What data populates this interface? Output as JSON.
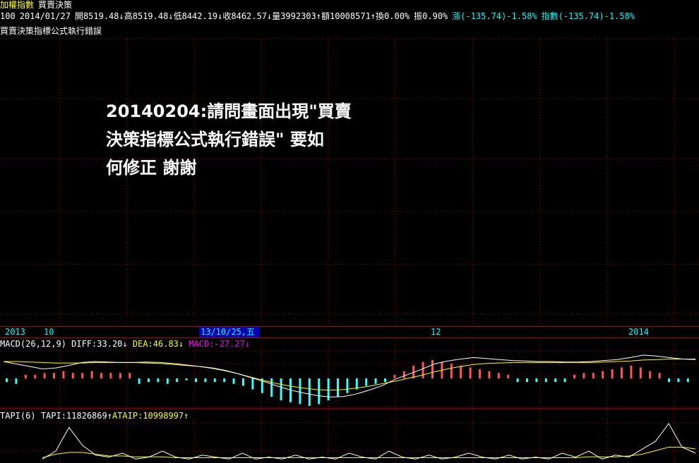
{
  "header": {
    "index_name": "加權指數",
    "strategy_name": "買賣決策",
    "period": "100",
    "date": "2014/01/27",
    "open": "開8519.48↓",
    "high": "高8519.48↓",
    "low": "低8442.19↓",
    "close": "收8462.57↓",
    "volume": "量3992303↑",
    "amount": "額10008571↑",
    "turnover": "換0.00%",
    "amplitude": "振0.90%",
    "change": "漲(-135.74)-1.58%",
    "index_change": "指數(-135.74)-1.58%"
  },
  "subtitle": "買賣決策指標公式執行錯誤",
  "question": {
    "line1": "20140204:請問畫面出現\"買賣",
    "line2": "決策指標公式執行錯誤\" 要如",
    "line3": "何修正  謝謝"
  },
  "axis": {
    "label_2013": "2013",
    "label_10": "10",
    "selected_date": "13/10/25,五",
    "label_12": "12",
    "label_2014": "2014"
  },
  "macd_legend": {
    "name": "MACD(26,12,9)",
    "diff": "DIFF:33.20↓",
    "dea": "DEA:46.83↓",
    "macd": "MACD:-27.27↓"
  },
  "tapi_legend": {
    "name": "TAPI(6)",
    "tapi": "TAPI:11826869↑",
    "ataip": "ATAIP:10998997↑"
  },
  "colors": {
    "grid": "#c00000",
    "bar_up": "#ff5555",
    "bar_down": "#33ffff",
    "diff_line": "#ffffff",
    "dea_line": "#ffff00"
  },
  "macd_histogram": [
    -2,
    -3,
    2,
    2,
    3,
    3,
    4,
    3,
    3,
    4,
    3,
    3,
    3,
    3,
    -3,
    -2,
    -2,
    -3,
    -2,
    -1,
    -2,
    -2,
    -2,
    -2,
    -3,
    -4,
    -6,
    -8,
    -10,
    -12,
    -13,
    -14,
    -15,
    -14,
    -12,
    -10,
    -8,
    -6,
    -4,
    -3,
    -2,
    2,
    4,
    7,
    9,
    10,
    9,
    8,
    7,
    6,
    5,
    4,
    3,
    2,
    -2,
    -2,
    -2,
    -2,
    -2,
    -2,
    2,
    3,
    3,
    4,
    5,
    6,
    7,
    6,
    4,
    3,
    -2,
    -2,
    -2
  ],
  "macd_diff": [
    1,
    0.5,
    0,
    -0.5,
    -0.3,
    0.2,
    0.8,
    1,
    0.9,
    0.8,
    0.8,
    0.9,
    0.8,
    0.6,
    0.3,
    0,
    -0.3,
    -0.8,
    -1.5,
    -2.3,
    -3.1,
    -4,
    -4.8,
    -5.4,
    -5.9,
    -6.2,
    -6.1,
    -5.6,
    -4.8,
    -3.9,
    -2.6,
    -1.6,
    -0.6,
    0.5,
    1.1,
    1.5,
    1.8,
    1.6,
    1.4,
    1.2,
    1.1,
    1,
    1,
    0.9,
    0.9,
    1,
    1.2,
    1.4,
    1.8,
    2.3,
    2.1,
    1.8,
    1.5,
    1.4
  ],
  "macd_dea": [
    1,
    1,
    0.9,
    0.8,
    0.7,
    0.7,
    0.7,
    0.8,
    0.8,
    0.8,
    0.8,
    0.7,
    0.6,
    0.4,
    0.2,
    0,
    -0.4,
    -0.9,
    -1.5,
    -2.2,
    -2.9,
    -3.5,
    -4,
    -4.4,
    -4.7,
    -4.8,
    -4.7,
    -4.4,
    -4,
    -3.5,
    -3,
    -2.4,
    -1.8,
    -1.1,
    -0.5,
    0,
    0.4,
    0.6,
    0.7,
    0.8,
    0.8,
    0.8,
    0.8,
    0.8,
    0.8,
    0.8,
    0.9,
    1,
    1.1,
    1.3,
    1.4,
    1.5,
    1.5,
    1.5
  ],
  "tapi_values": [
    0.2,
    0.6,
    1.8,
    0.9,
    0.4,
    0.3,
    0.5,
    0.2,
    0.3,
    0.6,
    0.3,
    0.2,
    0.4,
    0.3,
    0.2,
    0.5,
    0.2,
    0.3,
    0.2,
    0.4,
    0.2,
    0.3,
    0.2,
    0.5,
    0.3,
    0.2,
    0.6,
    0.3,
    0.2,
    0.4,
    0.2,
    0.3,
    0.5,
    0.3,
    0.2,
    0.4,
    0.2,
    0.3,
    0.2,
    0.5,
    0.3,
    0.6,
    0.2,
    0.4,
    0.3,
    0.7,
    1.1,
    2.0,
    0.8,
    0.5
  ],
  "ataip_values": [
    0.3,
    0.5,
    0.6,
    0.6,
    0.5,
    0.4,
    0.4,
    0.35,
    0.35,
    0.35,
    0.3,
    0.3,
    0.3,
    0.3,
    0.3,
    0.3,
    0.3,
    0.3,
    0.3,
    0.3,
    0.3,
    0.3,
    0.3,
    0.3,
    0.3,
    0.3,
    0.3,
    0.3,
    0.3,
    0.3,
    0.3,
    0.3,
    0.3,
    0.3,
    0.3,
    0.3,
    0.3,
    0.3,
    0.3,
    0.3,
    0.3,
    0.35,
    0.35,
    0.35,
    0.4,
    0.5,
    0.7,
    0.9,
    0.9,
    0.8
  ]
}
